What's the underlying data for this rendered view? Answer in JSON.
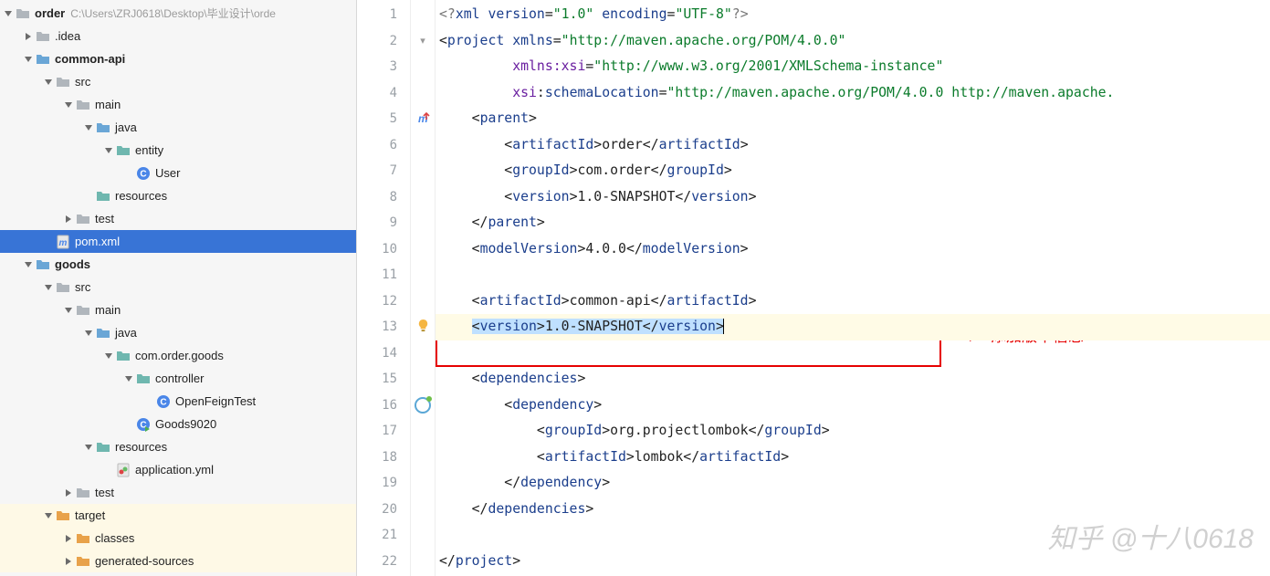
{
  "sidebar": {
    "project": {
      "name": "order",
      "path": "C:\\Users\\ZRJ0618\\Desktop\\毕业设计\\orde"
    },
    "nodes": [
      {
        "indent": 1,
        "arrow": "right",
        "icon": "folder",
        "label": ".idea"
      },
      {
        "indent": 1,
        "arrow": "down",
        "icon": "folder-blue",
        "label": "common-api",
        "bold": true
      },
      {
        "indent": 2,
        "arrow": "down",
        "icon": "folder",
        "label": "src"
      },
      {
        "indent": 3,
        "arrow": "down",
        "icon": "folder",
        "label": "main"
      },
      {
        "indent": 4,
        "arrow": "down",
        "icon": "folder-blue",
        "label": "java"
      },
      {
        "indent": 5,
        "arrow": "down",
        "icon": "folder-teal",
        "label": "entity"
      },
      {
        "indent": 6,
        "arrow": "none",
        "icon": "class",
        "label": "User"
      },
      {
        "indent": 4,
        "arrow": "none",
        "icon": "folder-teal",
        "label": "resources"
      },
      {
        "indent": 3,
        "arrow": "right",
        "icon": "folder",
        "label": "test"
      },
      {
        "indent": 2,
        "arrow": "none",
        "icon": "file-m",
        "label": "pom.xml",
        "selected": true
      },
      {
        "indent": 1,
        "arrow": "down",
        "icon": "folder-blue",
        "label": "goods",
        "bold": true
      },
      {
        "indent": 2,
        "arrow": "down",
        "icon": "folder",
        "label": "src"
      },
      {
        "indent": 3,
        "arrow": "down",
        "icon": "folder",
        "label": "main"
      },
      {
        "indent": 4,
        "arrow": "down",
        "icon": "folder-blue",
        "label": "java"
      },
      {
        "indent": 5,
        "arrow": "down",
        "icon": "folder-teal",
        "label": "com.order.goods"
      },
      {
        "indent": 6,
        "arrow": "down",
        "icon": "folder-teal",
        "label": "controller"
      },
      {
        "indent": 7,
        "arrow": "none",
        "icon": "class",
        "label": "OpenFeignTest"
      },
      {
        "indent": 6,
        "arrow": "none",
        "icon": "class-run",
        "label": "Goods9020"
      },
      {
        "indent": 4,
        "arrow": "down",
        "icon": "folder-teal",
        "label": "resources"
      },
      {
        "indent": 5,
        "arrow": "none",
        "icon": "file-yml",
        "label": "application.yml"
      },
      {
        "indent": 3,
        "arrow": "right",
        "icon": "folder",
        "label": "test"
      },
      {
        "indent": 2,
        "arrow": "down",
        "icon": "folder-orange",
        "label": "target",
        "targetBg": true
      },
      {
        "indent": 3,
        "arrow": "right",
        "icon": "folder-orange",
        "label": "classes",
        "targetBg": true
      },
      {
        "indent": 3,
        "arrow": "right",
        "icon": "folder-orange",
        "label": "generated-sources",
        "targetBg": true
      }
    ]
  },
  "editor": {
    "lines": [
      {
        "n": 1,
        "gx": "",
        "seg": [
          [
            "pi",
            "<?"
          ],
          [
            "tag",
            "xml"
          ],
          [
            "t",
            " "
          ],
          [
            "attr",
            "version"
          ],
          [
            "p",
            "="
          ],
          [
            "str",
            "\"1.0\""
          ],
          [
            "t",
            " "
          ],
          [
            "attr",
            "encoding"
          ],
          [
            "p",
            "="
          ],
          [
            "str",
            "\"UTF-8\""
          ],
          [
            "pi",
            "?>"
          ]
        ]
      },
      {
        "n": 2,
        "gx": "fold",
        "seg": [
          [
            "p",
            "<"
          ],
          [
            "tag",
            "project"
          ],
          [
            "t",
            " "
          ],
          [
            "attr",
            "xmlns"
          ],
          [
            "p",
            "="
          ],
          [
            "str",
            "\"http://maven.apache.org/POM/4.0.0\""
          ]
        ]
      },
      {
        "n": 3,
        "seg": [
          [
            "t",
            "         "
          ],
          [
            "ns",
            "xmlns:xsi"
          ],
          [
            "p",
            "="
          ],
          [
            "str",
            "\"http://www.w3.org/2001/XMLSchema-instance\""
          ]
        ]
      },
      {
        "n": 4,
        "seg": [
          [
            "t",
            "         "
          ],
          [
            "ns",
            "xsi"
          ],
          [
            "p",
            ":"
          ],
          [
            "attr",
            "schemaLocation"
          ],
          [
            "p",
            "="
          ],
          [
            "str",
            "\"http://maven.apache.org/POM/4.0.0 http://maven.apache."
          ]
        ]
      },
      {
        "n": 5,
        "gx": "mavenup",
        "seg": [
          [
            "t",
            "    "
          ],
          [
            "p",
            "<"
          ],
          [
            "tag",
            "parent"
          ],
          [
            "p",
            ">"
          ]
        ]
      },
      {
        "n": 6,
        "seg": [
          [
            "t",
            "        "
          ],
          [
            "p",
            "<"
          ],
          [
            "tag",
            "artifactId"
          ],
          [
            "p",
            ">"
          ],
          [
            "t",
            "order"
          ],
          [
            "p",
            "</"
          ],
          [
            "tag",
            "artifactId"
          ],
          [
            "p",
            ">"
          ]
        ]
      },
      {
        "n": 7,
        "seg": [
          [
            "t",
            "        "
          ],
          [
            "p",
            "<"
          ],
          [
            "tag",
            "groupId"
          ],
          [
            "p",
            ">"
          ],
          [
            "t",
            "com.order"
          ],
          [
            "p",
            "</"
          ],
          [
            "tag",
            "groupId"
          ],
          [
            "p",
            ">"
          ]
        ]
      },
      {
        "n": 8,
        "seg": [
          [
            "t",
            "        "
          ],
          [
            "p",
            "<"
          ],
          [
            "tag",
            "version"
          ],
          [
            "p",
            ">"
          ],
          [
            "t",
            "1.0-SNAPSHOT"
          ],
          [
            "p",
            "</"
          ],
          [
            "tag",
            "version"
          ],
          [
            "p",
            ">"
          ]
        ]
      },
      {
        "n": 9,
        "seg": [
          [
            "t",
            "    "
          ],
          [
            "p",
            "</"
          ],
          [
            "tag",
            "parent"
          ],
          [
            "p",
            ">"
          ]
        ]
      },
      {
        "n": 10,
        "seg": [
          [
            "t",
            "    "
          ],
          [
            "p",
            "<"
          ],
          [
            "tag",
            "modelVersion"
          ],
          [
            "p",
            ">"
          ],
          [
            "t",
            "4.0.0"
          ],
          [
            "p",
            "</"
          ],
          [
            "tag",
            "modelVersion"
          ],
          [
            "p",
            ">"
          ]
        ]
      },
      {
        "n": 11,
        "seg": [
          [
            "t",
            ""
          ]
        ]
      },
      {
        "n": 12,
        "seg": [
          [
            "t",
            "    "
          ],
          [
            "p",
            "<"
          ],
          [
            "tag",
            "artifactId"
          ],
          [
            "p",
            ">"
          ],
          [
            "t",
            "common-api"
          ],
          [
            "p",
            "</"
          ],
          [
            "tag",
            "artifactId"
          ],
          [
            "p",
            ">"
          ]
        ]
      },
      {
        "n": 13,
        "gx": "bulb",
        "band": true,
        "selLine": true,
        "seg": [
          [
            "t",
            "    "
          ],
          [
            "p",
            "<"
          ],
          [
            "tag",
            "version"
          ],
          [
            "p",
            ">"
          ],
          [
            "t",
            "1.0-SNAPSHOT"
          ],
          [
            "p",
            "</"
          ],
          [
            "tag",
            "version"
          ],
          [
            "p",
            ">"
          ]
        ]
      },
      {
        "n": 14,
        "seg": [
          [
            "t",
            ""
          ]
        ]
      },
      {
        "n": 15,
        "seg": [
          [
            "t",
            "    "
          ],
          [
            "p",
            "<"
          ],
          [
            "tag",
            "dependencies"
          ],
          [
            "p",
            ">"
          ]
        ]
      },
      {
        "n": 16,
        "gx": "ring",
        "seg": [
          [
            "t",
            "        "
          ],
          [
            "p",
            "<"
          ],
          [
            "tag",
            "dependency"
          ],
          [
            "p",
            ">"
          ]
        ]
      },
      {
        "n": 17,
        "seg": [
          [
            "t",
            "            "
          ],
          [
            "p",
            "<"
          ],
          [
            "tag",
            "groupId"
          ],
          [
            "p",
            ">"
          ],
          [
            "t",
            "org.projectlombok"
          ],
          [
            "p",
            "</"
          ],
          [
            "tag",
            "groupId"
          ],
          [
            "p",
            ">"
          ]
        ]
      },
      {
        "n": 18,
        "seg": [
          [
            "t",
            "            "
          ],
          [
            "p",
            "<"
          ],
          [
            "tag",
            "artifactId"
          ],
          [
            "p",
            ">"
          ],
          [
            "t",
            "lombok"
          ],
          [
            "p",
            "</"
          ],
          [
            "tag",
            "artifactId"
          ],
          [
            "p",
            ">"
          ]
        ]
      },
      {
        "n": 19,
        "seg": [
          [
            "t",
            "        "
          ],
          [
            "p",
            "</"
          ],
          [
            "tag",
            "dependency"
          ],
          [
            "p",
            ">"
          ]
        ]
      },
      {
        "n": 20,
        "seg": [
          [
            "t",
            "    "
          ],
          [
            "p",
            "</"
          ],
          [
            "tag",
            "dependencies"
          ],
          [
            "p",
            ">"
          ]
        ]
      },
      {
        "n": 21,
        "seg": [
          [
            "t",
            ""
          ]
        ]
      },
      {
        "n": 22,
        "seg": [
          [
            "p",
            "</"
          ],
          [
            "tag",
            "project"
          ],
          [
            "p",
            ">"
          ]
        ]
      }
    ]
  },
  "annotation": {
    "text": "添加版本信息"
  },
  "watermark": "知乎 @十八0618"
}
